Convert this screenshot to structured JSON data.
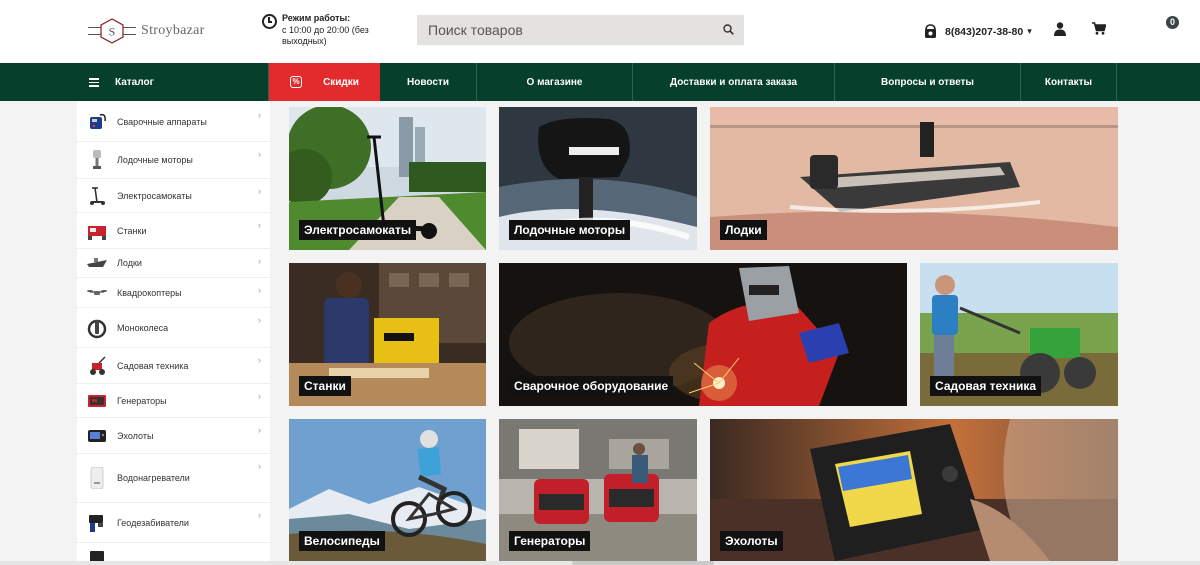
{
  "header": {
    "logo_text": "Stroybazar",
    "logo_letter": "S",
    "hours_title": "Режим работы:",
    "hours_text": "с 10:00 до 20:00 (без выходных)",
    "search_placeholder": "Поиск товаров",
    "phone": "8(843)207-38-80",
    "cart_count": "0",
    "icons": [
      "clock-icon",
      "search-icon",
      "phone-icon",
      "user-icon",
      "cart-icon"
    ]
  },
  "nav": {
    "items": [
      {
        "label": "Каталог"
      },
      {
        "label": "Скидки"
      },
      {
        "label": "Новости"
      },
      {
        "label": "О магазине"
      },
      {
        "label": "Доставки и оплата заказа"
      },
      {
        "label": "Вопросы и ответы"
      },
      {
        "label": "Контакты"
      }
    ]
  },
  "sidebar": {
    "items": [
      {
        "label": "Сварочные аппараты"
      },
      {
        "label": "Лодочные моторы"
      },
      {
        "label": "Электросамокаты"
      },
      {
        "label": "Станки"
      },
      {
        "label": "Лодки"
      },
      {
        "label": "Квадрокоптеры"
      },
      {
        "label": "Моноколеса"
      },
      {
        "label": "Садовая техника"
      },
      {
        "label": "Генераторы"
      },
      {
        "label": "Эхолоты"
      },
      {
        "label": "Водонагреватели"
      },
      {
        "label": "Геодезабиватели"
      }
    ]
  },
  "tiles": [
    {
      "caption": "Электросамокаты"
    },
    {
      "caption": "Лодочные моторы"
    },
    {
      "caption": "Лодки"
    },
    {
      "caption": "Станки"
    },
    {
      "caption": "Сварочное оборудование"
    },
    {
      "caption": "Садовая техника"
    },
    {
      "caption": "Велосипеды"
    },
    {
      "caption": "Генераторы"
    },
    {
      "caption": "Эхолоты"
    }
  ],
  "colors": {
    "nav_bg": "#063f2c",
    "sale_bg": "#e32b2e",
    "search_bg": "#e4e2e0"
  }
}
